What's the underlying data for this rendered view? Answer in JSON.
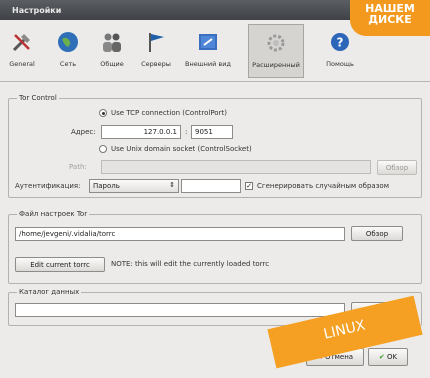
{
  "window": {
    "title": "Настройки"
  },
  "toolbar": {
    "items": [
      {
        "label": "General",
        "icon": "tools-icon"
      },
      {
        "label": "Сеть",
        "icon": "globe-icon"
      },
      {
        "label": "Общие",
        "icon": "people-icon"
      },
      {
        "label": "Серверы",
        "icon": "flag-icon"
      },
      {
        "label": "Внешний вид",
        "icon": "appearance-icon"
      },
      {
        "label": "Расширенный",
        "icon": "gear-icon",
        "active": true
      },
      {
        "label": "Помощь",
        "icon": "help-icon"
      }
    ]
  },
  "tor_control": {
    "legend": "Tor Control",
    "tcp_option": "Use TCP connection (ControlPort)",
    "address_label": "Адрес:",
    "address_value": "127.0.0.1",
    "port_separator": ":",
    "port_value": "9051",
    "socket_option": "Use Unix domain socket (ControlSocket)",
    "path_label": "Path:",
    "browse_label": "Обзор",
    "auth_label": "Аутентификация:",
    "auth_value": "Пароль",
    "random_label": "Сгенерировать случайным образом"
  },
  "torrc": {
    "legend": "Файл настроек Tor",
    "path_value": "/home/jevgeni/.vidalia/torrc",
    "browse_label": "Обзор",
    "edit_button": "Edit current torrc",
    "note": "NOTE: this will edit the currently loaded torrc"
  },
  "data_dir": {
    "legend": "Каталог данных",
    "browse_label": "Обзор"
  },
  "footer": {
    "cancel_label": "Отмена",
    "ok_label": "OK"
  },
  "badges": {
    "top_line1": "НАШЕМ",
    "top_line2": "ДИСКЕ",
    "linux": "LINUX"
  },
  "colors": {
    "badge_orange": "#f39a1e",
    "titlebar": "#4a4d51",
    "panel": "#ecebea"
  }
}
